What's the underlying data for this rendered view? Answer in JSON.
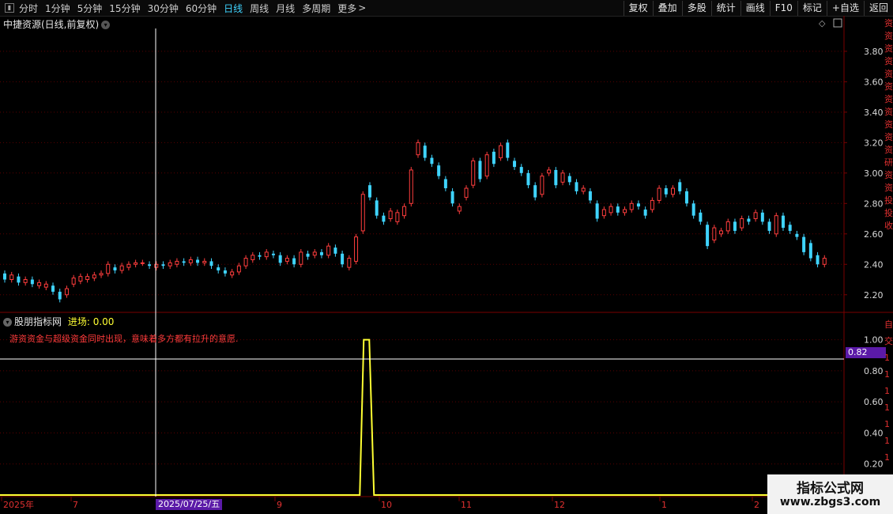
{
  "toolbar": {
    "pin_icon": "pin-icon",
    "periods": [
      "分时",
      "1分钟",
      "5分钟",
      "15分钟",
      "30分钟",
      "60分钟",
      "日线",
      "周线",
      "月线",
      "多周期",
      "更多"
    ],
    "active_period": "日线",
    "more_suffix": ">",
    "actions": [
      "复权",
      "叠加",
      "多股",
      "统计",
      "画线",
      "F10",
      "标记",
      "+自选",
      "返回"
    ]
  },
  "main_chart": {
    "title": "中捷资源(日线,前复权)",
    "y_ticks": [
      "3.80",
      "3.60",
      "3.40",
      "3.20",
      "3.00",
      "2.80",
      "2.60",
      "2.40",
      "2.20"
    ],
    "colors": {
      "up": "#ff3d3d",
      "down": "#3fd4ff",
      "grid": "#5a0000",
      "crosshair": "#ffffff"
    }
  },
  "indicator": {
    "name": "股朋指标网",
    "value_label": "进场: 0.00",
    "description": "游资资金与超级资金同时出现，意味着多方都有拉升的意愿.",
    "y_ticks": [
      "1.00",
      "0.80",
      "0.60",
      "0.40",
      "0.20"
    ],
    "cursor_value": "0.82",
    "line_color": "#ffff33"
  },
  "x_axis": {
    "labels": [
      "2025年",
      "7",
      "9",
      "10",
      "11",
      "12",
      "1",
      "2"
    ],
    "cursor_date": "2025/07/25/五"
  },
  "side_strip": {
    "upper": "资资资资资资资资资资资研资资投投收",
    "lower": "自交1111111"
  },
  "watermark": {
    "line1": "指标公式网",
    "line2": "www.zbgs3.com"
  },
  "chart_data": {
    "type": "candlestick",
    "title": "中捷资源(日线,前复权)",
    "ylim": [
      2.1,
      3.95
    ],
    "candles": [
      [
        2.34,
        2.3
      ],
      [
        2.3,
        2.33
      ],
      [
        2.32,
        2.28
      ],
      [
        2.28,
        2.3
      ],
      [
        2.3,
        2.27
      ],
      [
        2.26,
        2.28
      ],
      [
        2.25,
        2.27
      ],
      [
        2.26,
        2.22
      ],
      [
        2.22,
        2.17
      ],
      [
        2.2,
        2.24
      ],
      [
        2.27,
        2.31
      ],
      [
        2.29,
        2.32
      ],
      [
        2.3,
        2.32
      ],
      [
        2.31,
        2.33
      ],
      [
        2.33,
        2.34
      ],
      [
        2.34,
        2.4
      ],
      [
        2.38,
        2.36
      ],
      [
        2.36,
        2.39
      ],
      [
        2.38,
        2.4
      ],
      [
        2.4,
        2.41
      ],
      [
        2.41,
        2.41
      ],
      [
        2.4,
        2.39
      ],
      [
        2.38,
        2.4
      ],
      [
        2.4,
        2.39
      ],
      [
        2.39,
        2.41
      ],
      [
        2.4,
        2.42
      ],
      [
        2.42,
        2.41
      ],
      [
        2.41,
        2.43
      ],
      [
        2.43,
        2.41
      ],
      [
        2.41,
        2.42
      ],
      [
        2.42,
        2.39
      ],
      [
        2.38,
        2.36
      ],
      [
        2.36,
        2.34
      ],
      [
        2.33,
        2.35
      ],
      [
        2.35,
        2.39
      ],
      [
        2.39,
        2.44
      ],
      [
        2.43,
        2.46
      ],
      [
        2.46,
        2.45
      ],
      [
        2.45,
        2.48
      ],
      [
        2.47,
        2.46
      ],
      [
        2.46,
        2.41
      ],
      [
        2.42,
        2.44
      ],
      [
        2.44,
        2.4
      ],
      [
        2.4,
        2.48
      ],
      [
        2.47,
        2.45
      ],
      [
        2.46,
        2.48
      ],
      [
        2.48,
        2.46
      ],
      [
        2.46,
        2.52
      ],
      [
        2.51,
        2.47
      ],
      [
        2.47,
        2.4
      ],
      [
        2.38,
        2.44
      ],
      [
        2.42,
        2.58
      ],
      [
        2.62,
        2.86
      ],
      [
        2.92,
        2.84
      ],
      [
        2.82,
        2.72
      ],
      [
        2.72,
        2.68
      ],
      [
        2.7,
        2.75
      ],
      [
        2.68,
        2.74
      ],
      [
        2.72,
        2.78
      ],
      [
        2.8,
        3.02
      ],
      [
        3.12,
        3.2
      ],
      [
        3.18,
        3.1
      ],
      [
        3.1,
        3.06
      ],
      [
        3.05,
        2.98
      ],
      [
        2.96,
        2.9
      ],
      [
        2.88,
        2.8
      ],
      [
        2.75,
        2.78
      ],
      [
        2.84,
        2.9
      ],
      [
        2.92,
        3.08
      ],
      [
        3.08,
        2.96
      ],
      [
        2.98,
        3.12
      ],
      [
        3.14,
        3.06
      ],
      [
        3.1,
        3.18
      ],
      [
        3.2,
        3.1
      ],
      [
        3.08,
        3.04
      ],
      [
        3.04,
        3.0
      ],
      [
        3.0,
        2.92
      ],
      [
        2.92,
        2.84
      ],
      [
        2.86,
        2.98
      ],
      [
        3.0,
        3.02
      ],
      [
        3.02,
        2.92
      ],
      [
        2.94,
        3.0
      ],
      [
        2.98,
        2.94
      ],
      [
        2.94,
        2.88
      ],
      [
        2.88,
        2.9
      ],
      [
        2.88,
        2.82
      ],
      [
        2.8,
        2.7
      ],
      [
        2.72,
        2.76
      ],
      [
        2.74,
        2.78
      ],
      [
        2.78,
        2.74
      ],
      [
        2.74,
        2.76
      ],
      [
        2.76,
        2.8
      ],
      [
        2.8,
        2.78
      ],
      [
        2.76,
        2.72
      ],
      [
        2.76,
        2.82
      ],
      [
        2.82,
        2.9
      ],
      [
        2.9,
        2.86
      ],
      [
        2.86,
        2.9
      ],
      [
        2.94,
        2.88
      ],
      [
        2.88,
        2.8
      ],
      [
        2.8,
        2.72
      ],
      [
        2.74,
        2.68
      ],
      [
        2.66,
        2.52
      ],
      [
        2.56,
        2.64
      ],
      [
        2.6,
        2.62
      ],
      [
        2.62,
        2.68
      ],
      [
        2.68,
        2.62
      ],
      [
        2.64,
        2.7
      ],
      [
        2.7,
        2.68
      ],
      [
        2.7,
        2.74
      ],
      [
        2.74,
        2.68
      ],
      [
        2.68,
        2.62
      ],
      [
        2.6,
        2.72
      ],
      [
        2.72,
        2.64
      ],
      [
        2.66,
        2.62
      ],
      [
        2.6,
        2.58
      ],
      [
        2.58,
        2.48
      ],
      [
        2.54,
        2.44
      ],
      [
        2.46,
        2.4
      ],
      [
        2.4,
        2.44
      ]
    ],
    "indicator_series": {
      "name": "进场",
      "values_note_spike_at_index": 52,
      "ylim": [
        0,
        1.1
      ]
    }
  }
}
